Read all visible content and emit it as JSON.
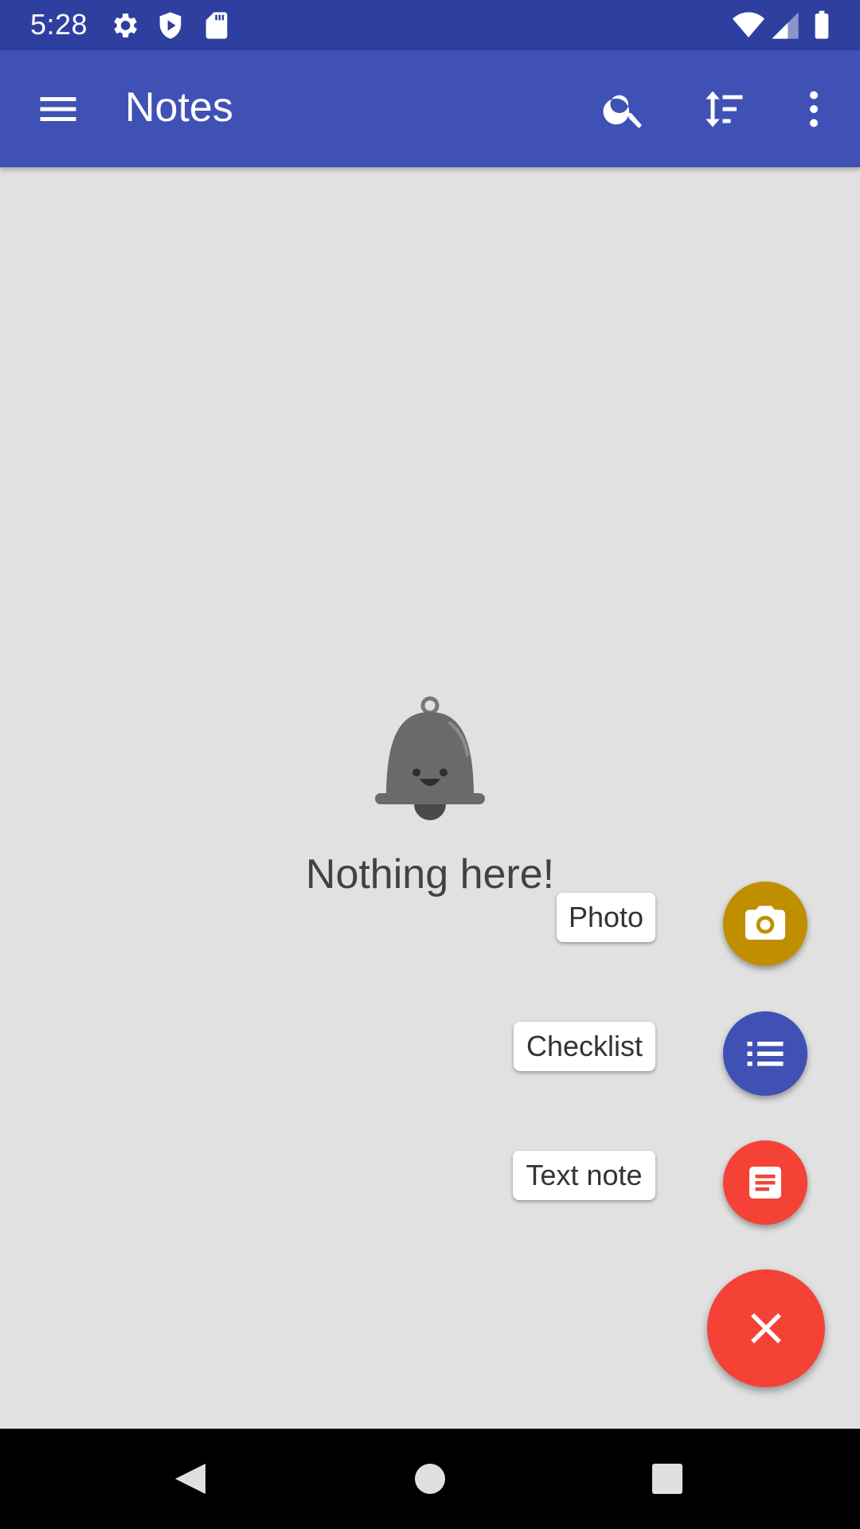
{
  "status_bar": {
    "time": "5:28",
    "icons": [
      "settings-icon",
      "shield-play-icon",
      "sd-card-icon",
      "wifi-icon",
      "signal-icon",
      "battery-icon"
    ]
  },
  "app_bar": {
    "title": "Notes",
    "icons": [
      "menu-icon",
      "search-icon",
      "sort-icon",
      "more-vert-icon"
    ]
  },
  "empty_state": {
    "icon": "bell-icon",
    "message": "Nothing here!"
  },
  "fab_menu": {
    "items": [
      {
        "label": "Photo",
        "icon": "camera-icon",
        "color": "#BF8F00"
      },
      {
        "label": "Checklist",
        "icon": "checklist-icon",
        "color": "#3F51B5"
      },
      {
        "label": "Text note",
        "icon": "text-note-icon",
        "color": "#F44336"
      }
    ],
    "main_icon": "close-icon",
    "main_color": "#F44336"
  },
  "nav_bar": {
    "icons": [
      "back-icon",
      "home-icon",
      "recents-icon"
    ]
  },
  "colors": {
    "primary": "#3F51B5",
    "primary_dark": "#2F3F9F",
    "background": "#E1E1E1"
  }
}
